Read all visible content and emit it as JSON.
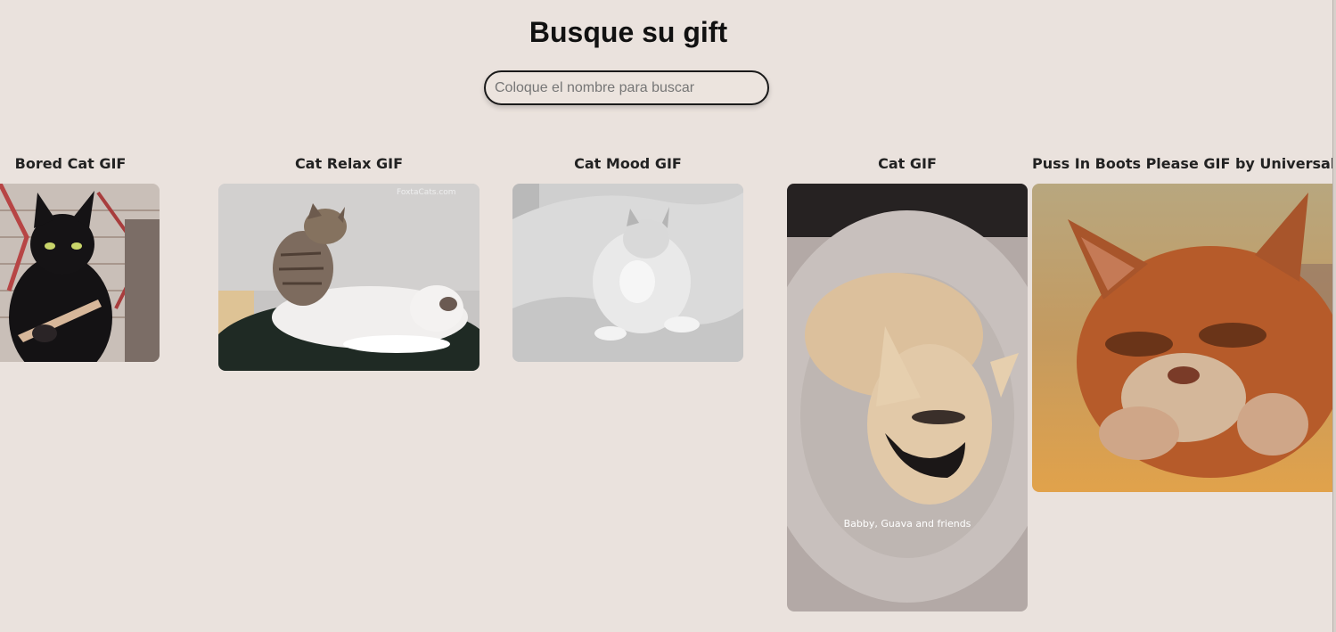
{
  "header": {
    "title": "Busque su gift"
  },
  "search": {
    "placeholder": "Coloque el nombre para buscar",
    "value": ""
  },
  "gifs": [
    {
      "title": "Bored Cat GIF"
    },
    {
      "title": "Cat Relax GIF"
    },
    {
      "title": "Cat Mood GIF"
    },
    {
      "title": "Cat GIF",
      "caption": "Babby, Guava and friends"
    },
    {
      "title": "Puss In Boots Please GIF by Universal Kids"
    }
  ],
  "watermarks": {
    "cat_relax": "FoxtaCats.com"
  }
}
